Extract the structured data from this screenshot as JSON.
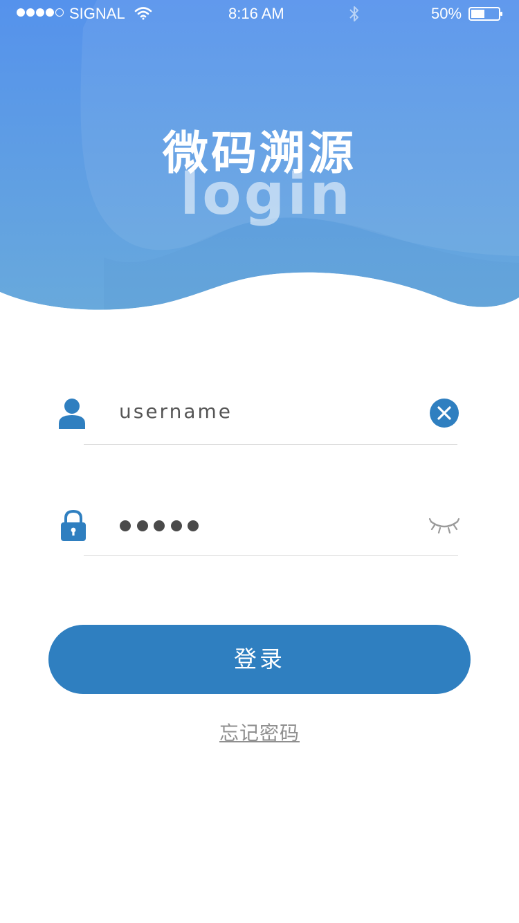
{
  "status_bar": {
    "carrier": "SIGNAL",
    "time": "8:16 AM",
    "battery_percent": "50%",
    "battery_level": 0.5,
    "signal_bars_filled": 4,
    "signal_bars_total": 5,
    "icons": [
      "wifi-icon",
      "bluetooth-icon",
      "battery-icon"
    ]
  },
  "brand": {
    "title": "微码溯源",
    "subtitle": "login"
  },
  "form": {
    "username": {
      "value": "username",
      "icon": "user-icon",
      "action_icon": "clear-icon"
    },
    "password": {
      "masked_length": 5,
      "icon": "lock-icon",
      "action_icon": "eye-closed-icon"
    }
  },
  "actions": {
    "login_label": "登录",
    "forgot_password_label": "忘记密码"
  },
  "colors": {
    "header_gradient_top": "#5592ec",
    "header_gradient_bottom": "#68a9dc",
    "primary": "#2f7fc0",
    "text_dark": "#555555",
    "link_gray": "#8f8f8f",
    "divider": "#dddddd"
  }
}
